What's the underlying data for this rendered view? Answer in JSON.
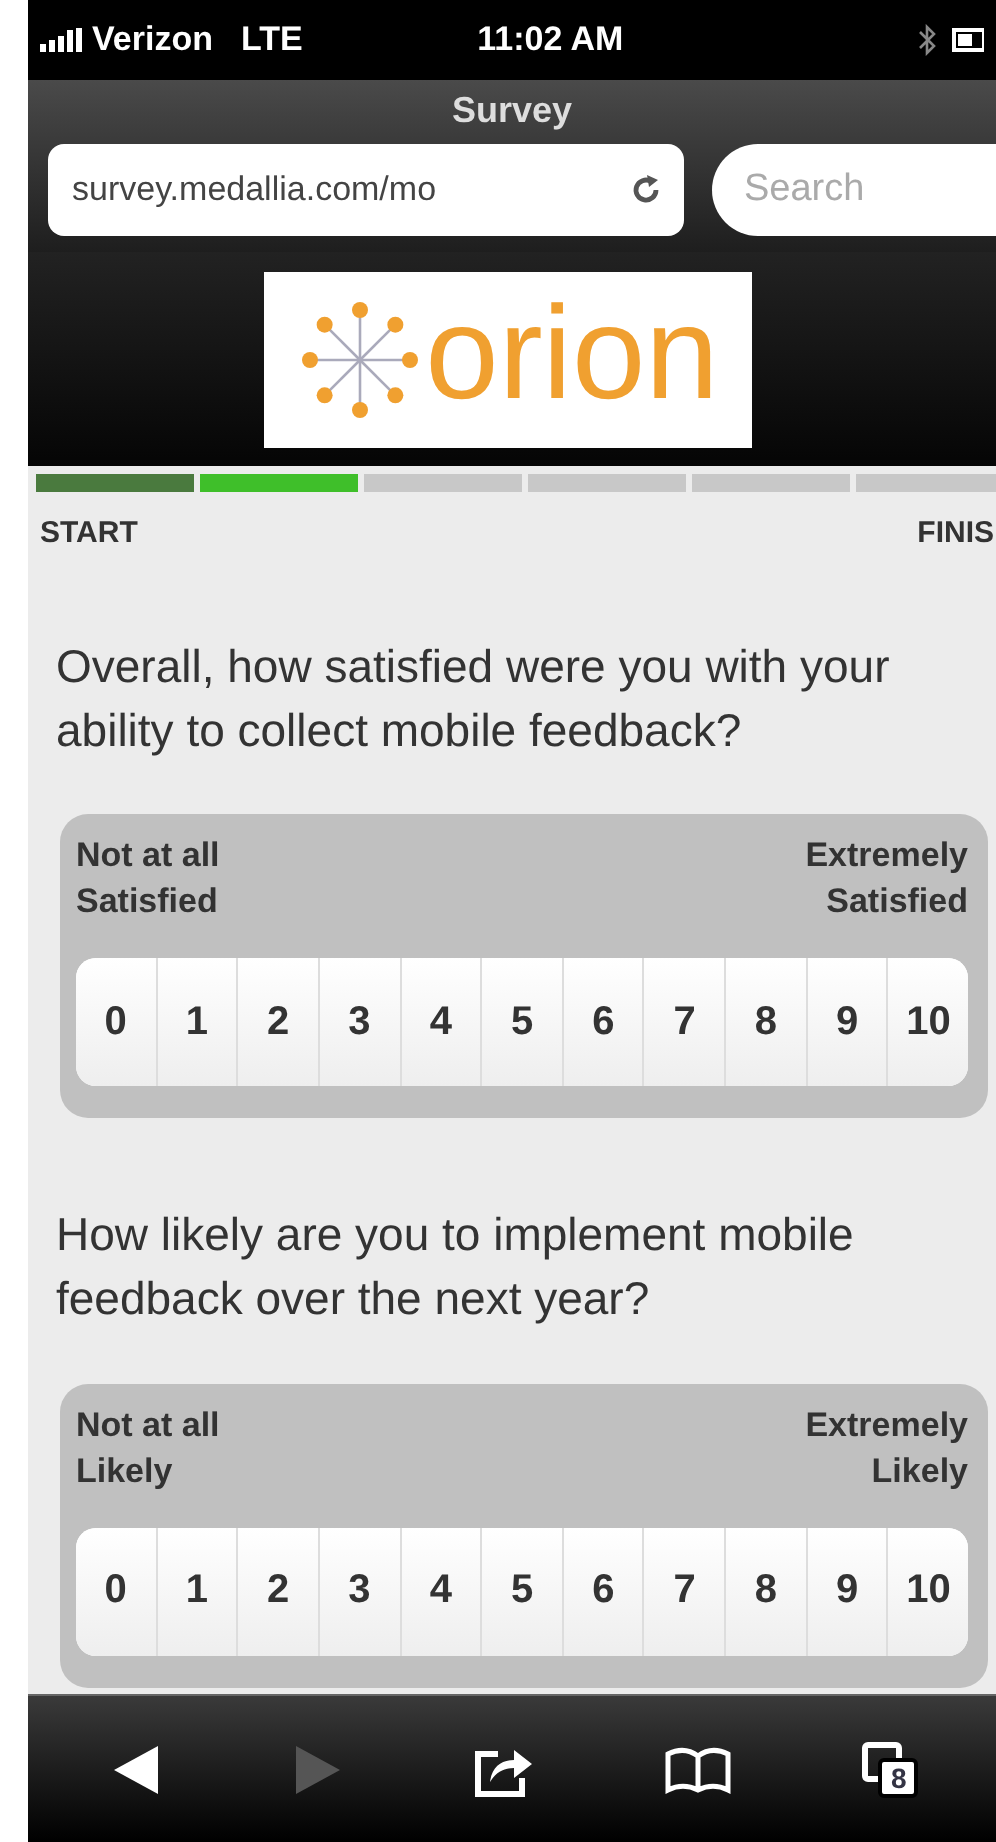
{
  "status_bar": {
    "carrier": "Verizon",
    "network": "LTE",
    "time": "11:02 AM"
  },
  "browser": {
    "title": "Survey",
    "url": "survey.medallia.com/mo",
    "search_placeholder": "Search"
  },
  "logo": {
    "text": "orion"
  },
  "progress": {
    "segments": [
      {
        "done": true,
        "selected": false
      },
      {
        "done": false,
        "selected": true
      },
      {
        "done": false,
        "selected": false
      },
      {
        "done": false,
        "selected": false
      },
      {
        "done": false,
        "selected": false
      },
      {
        "done": false,
        "selected": false
      }
    ],
    "start_label": "START",
    "finish_label": "FINIS"
  },
  "questions": [
    {
      "text": "Overall, how satisfied were you with your ability to collect mobile feedback?",
      "low_label": [
        "Not at all",
        "Satisfied"
      ],
      "high_label": [
        "Extremely",
        "Satisfied"
      ],
      "options": [
        "0",
        "1",
        "2",
        "3",
        "4",
        "5",
        "6",
        "7",
        "8",
        "9",
        "10"
      ]
    },
    {
      "text": "How likely are you to implement mobile feedback over the next year?",
      "low_label": [
        "Not at all",
        "Likely"
      ],
      "high_label": [
        "Extremely",
        "Likely"
      ],
      "options": [
        "0",
        "1",
        "2",
        "3",
        "4",
        "5",
        "6",
        "7",
        "8",
        "9",
        "10"
      ]
    }
  ],
  "toolbar": {
    "back_enabled": true,
    "forward_enabled": false,
    "tab_count": "8"
  }
}
